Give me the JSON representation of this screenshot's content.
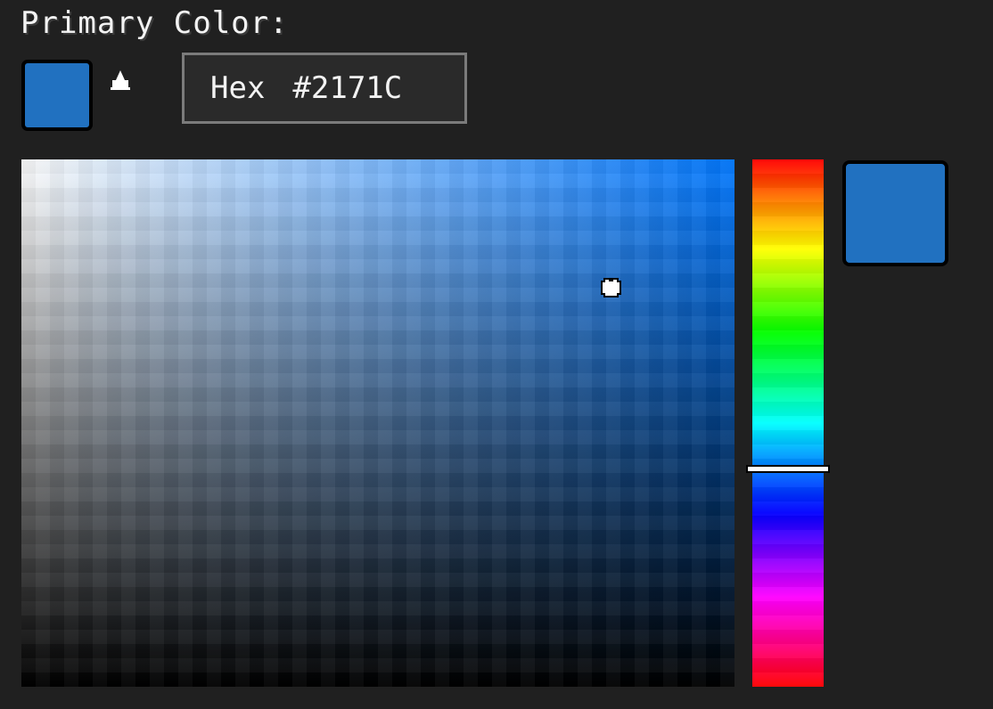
{
  "picker": {
    "title": "Primary Color:",
    "hex_label": "Hex",
    "hex_value": "#2171C",
    "current_color": "#2171C0",
    "hue_gradient_end_color": "#0077ff",
    "icons": {
      "arrow": "up-arrow-icon",
      "cursor": "sv-cursor-icon"
    }
  }
}
